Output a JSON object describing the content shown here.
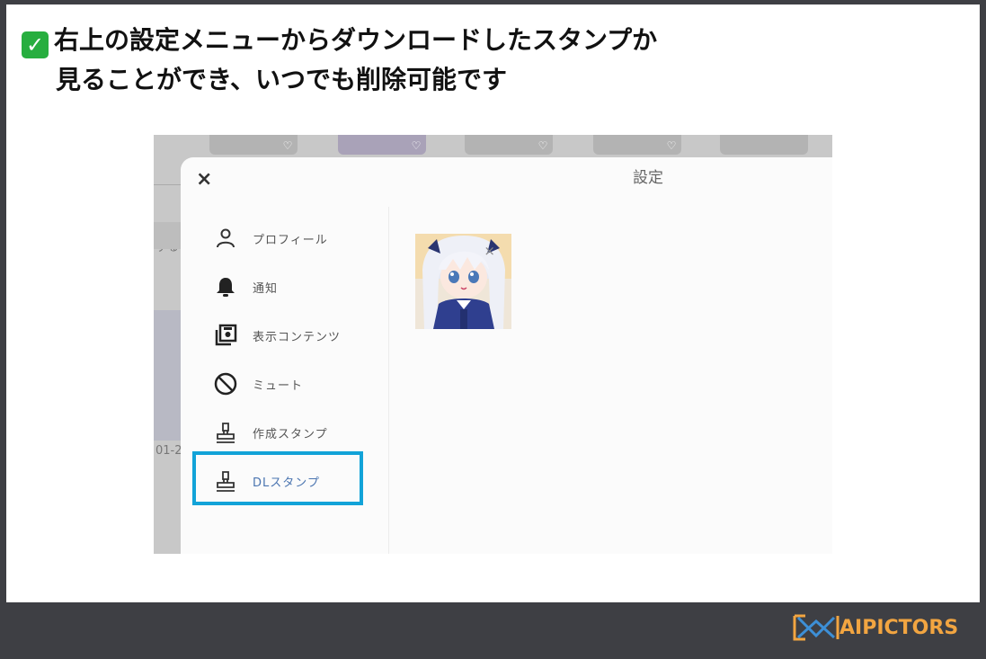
{
  "headline": {
    "line1": "右上の設定メニューからダウンロードしたスタンプか",
    "line2": "見ることができ、いつでも削除可能です"
  },
  "background": {
    "partial_text_1": "する",
    "partial_text_2": "01-2"
  },
  "settings": {
    "title": "設定",
    "close_symbol": "×",
    "menu": [
      {
        "label": "プロフィール",
        "icon": "person-icon"
      },
      {
        "label": "通知",
        "icon": "bell-icon"
      },
      {
        "label": "表示コンテンツ",
        "icon": "content-icon"
      },
      {
        "label": "ミュート",
        "icon": "block-icon"
      },
      {
        "label": "作成スタンプ",
        "icon": "stamp-icon"
      },
      {
        "label": "DLスタンプ",
        "icon": "stamp-icon",
        "active": true
      }
    ],
    "remove_symbol": "×"
  },
  "footer": {
    "brand": "AIPICTORS"
  },
  "colors": {
    "accent_highlight": "#12a3d8",
    "active_menu_text": "#4a74b0",
    "brand": "#f2a541",
    "check_green": "#27ae3f"
  }
}
